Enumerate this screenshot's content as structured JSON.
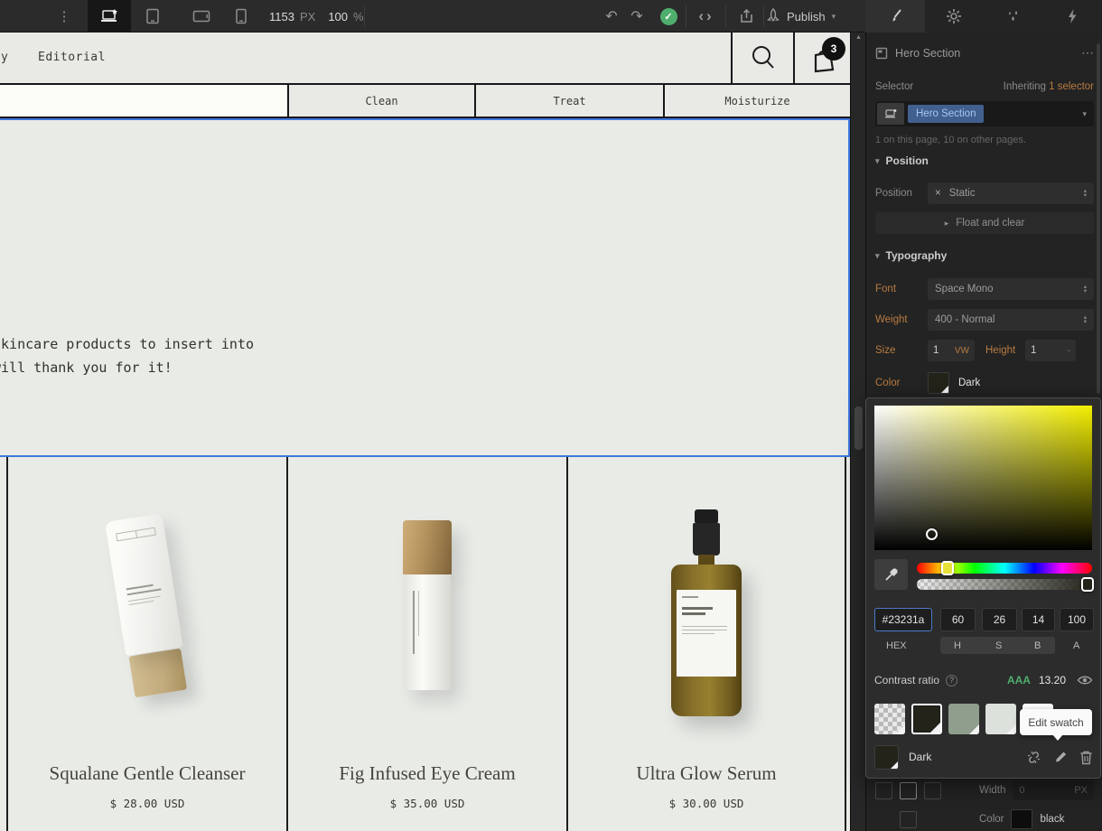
{
  "toolbar": {
    "canvas_width": "1153",
    "canvas_width_unit": "PX",
    "zoom": "100",
    "zoom_unit": "%",
    "publish_label": "Publish"
  },
  "icons": {
    "kebab": "⋮",
    "more": "⋯",
    "caret_down": "▾",
    "tri_right": "▸",
    "tri_up": "▴",
    "tri_down": "▾",
    "check": "✓",
    "close": "×",
    "undo": "↶",
    "redo": "↷",
    "angle_left": "‹",
    "angle_right": "›",
    "question": "?",
    "scroll_up": "▲"
  },
  "site": {
    "nav": {
      "clipped_item": "y",
      "editorial": "Editorial",
      "cart_count": "3"
    },
    "tabs": [
      "Clean",
      "Treat",
      "Moisturize"
    ],
    "hero": {
      "line1": "skincare products to insert into",
      "line2": "will thank you for it!"
    },
    "products": [
      {
        "name": "Squalane Gentle Cleanser",
        "price": "$ 28.00 USD"
      },
      {
        "name": "Fig Infused Eye Cream",
        "price": "$ 35.00 USD"
      },
      {
        "name": "Ultra Glow Serum",
        "price": "$ 30.00 USD"
      }
    ]
  },
  "panel": {
    "element_title": "Hero Section",
    "selector_label": "Selector",
    "inheriting_label": "Inheriting",
    "inheriting_value": "1 selector",
    "selector_tag": "Hero Section",
    "usage_note": "1 on this page, 10 on other pages.",
    "position_section": "Position",
    "position_label": "Position",
    "position_value": "Static",
    "float_clear_label": "Float and clear",
    "typography_section": "Typography",
    "font_label": "Font",
    "font_value": "Space Mono",
    "weight_label": "Weight",
    "weight_value": "400 - Normal",
    "size_label": "Size",
    "size_value": "1",
    "size_unit": "VW",
    "height_label": "Height",
    "height_value": "1",
    "height_unit": "-",
    "color_label": "Color",
    "color_value": "Dark"
  },
  "picker": {
    "hex": "#23231a",
    "h": "60",
    "s": "26",
    "b": "14",
    "a": "100",
    "hex_label": "HEX",
    "h_label": "H",
    "s_label": "S",
    "b_label": "B",
    "a_label": "A",
    "contrast_label": "Contrast ratio",
    "contrast_rating": "AAA",
    "contrast_value": "13.20",
    "tooltip": "Edit swatch",
    "swatch_name": "Dark",
    "swatches": [
      "transparent",
      "#23231a",
      "#8f9e8d",
      "#dde1dc",
      "#ffffff"
    ]
  },
  "borders_panel": {
    "width_label": "Width",
    "width_value": "0",
    "width_unit": "PX",
    "color_label": "Color",
    "color_value": "black"
  },
  "colors": {
    "selection_blue": "#3f78dd",
    "label_orange": "#b97b40",
    "selector_pill_bg": "#41608f",
    "contrast_green": "#4fae6d",
    "current_color": "#23231a"
  }
}
